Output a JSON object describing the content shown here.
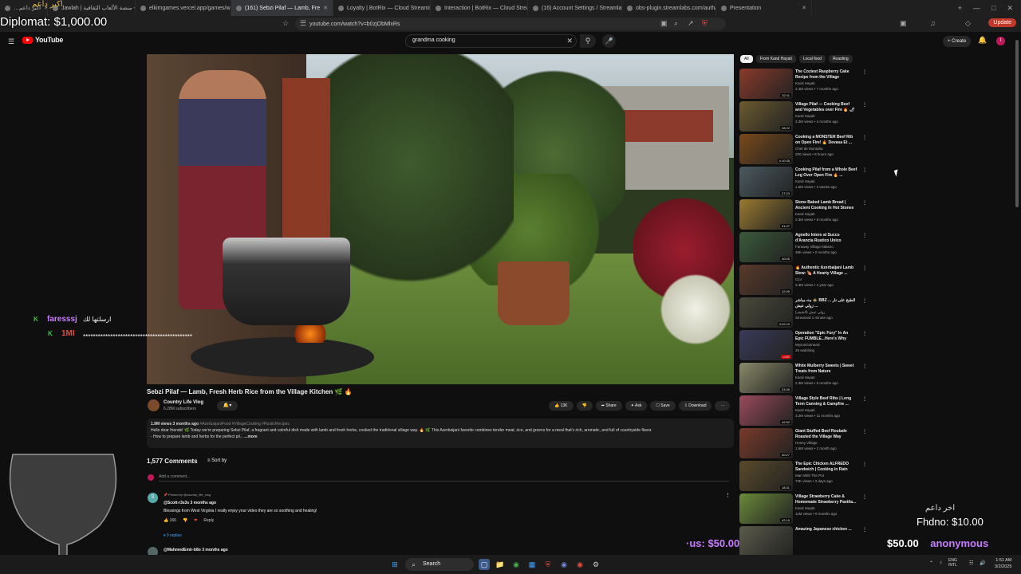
{
  "browser": {
    "tabs": [
      {
        "label": "…اكبر داعم",
        "active": false
      },
      {
        "label": "Jawlah | جولة - منصة الألعاب الثقافية",
        "active": false
      },
      {
        "label": "elkimgames.vercel.app/games/whea",
        "active": false
      },
      {
        "label": "(161) Sebzi Pilaf — Lamb, Fre",
        "active": true
      },
      {
        "label": "Loyalty | BotRix — Cloud Streaming",
        "active": false
      },
      {
        "label": "Interaction | BotRix — Cloud Stream",
        "active": false
      },
      {
        "label": "(16) Account Settings / Streamlabs",
        "active": false
      },
      {
        "label": "obs-plugin.streamlabs.com/auth/su",
        "active": false
      },
      {
        "label": "Presentation",
        "active": false
      }
    ],
    "url": "youtube.com/watch?v=b0zjObMlxRs",
    "update_label": "Update"
  },
  "youtube": {
    "logo_text": "YouTube",
    "search_value": "grandma cooking",
    "create_label": "+ Create",
    "avatar_letter": "I"
  },
  "video": {
    "title": "Sebzi Pilaf — Lamb, Fresh Herb Rice from the Village Kitchen 🌿 🔥",
    "channel": "Country Life Vlog",
    "subscribers": "6.28M subscribers",
    "likes": "13K",
    "actions": {
      "share": "Share",
      "ask": "Ask",
      "save": "Save",
      "download": "Download"
    },
    "description": {
      "meta": "1.9M views 3 months ago",
      "tags": "#AzerbaijaniFood #VillageCooking #RusticRecipes",
      "text": "Hello dear friends! 🌿 Today we're preparing Sebzi Pilaf, a fragrant and colorful dish made with lamb and fresh herbs, cooked the traditional village way. 🔥 🌿 This Azerbaijani favorite combines tender meat, rice, and greens for a meal that's rich, aromatic, and full of countryside flavor.",
      "line2": "- How to prepare lamb and herbs for the perfect pil...",
      "more": "...more"
    }
  },
  "comments": {
    "count": "1,577 Comments",
    "sort_label": "Sort by",
    "add_placeholder": "Add a comment...",
    "pinned": "Pinned by @country_life_vlog",
    "first": {
      "avatar_letter": "S",
      "user": "@Scott-r3s3s 3 months ago",
      "text": "Blessings from West Virginia I really enjoy your video they are so soothing and healing!",
      "likes": "166",
      "reply_label": "Reply",
      "replies": "9 replies"
    },
    "second_user": "@MahmedEmir-b8o 3 months ago"
  },
  "sidebar": {
    "chips": [
      "All",
      "From Kand Hayati",
      "Local food",
      "Roasting"
    ],
    "items": [
      {
        "title": "The Coziest Raspberry Cake Recipe from the Village",
        "channel": "Kand Hayati",
        "meta": "2.4M views • 7 months ago",
        "duration": "32:11",
        "color": "#8a3a2a"
      },
      {
        "title": "Village Pilaf — Cooking Beef and Vegetables over Fire 🔥 🌶",
        "channel": "Kand Hayati",
        "meta": "3.3M views • 4 months ago",
        "duration": "28:22",
        "color": "#6c5a30"
      },
      {
        "title": "Cooking a MONSTER Beef Rib on Open Fire! 🔥 Devasa Et ...",
        "channel": "Chef de Montaña",
        "meta": "200 views • 8 hours ago",
        "duration": "4:10:35",
        "color": "#7a4a1a"
      },
      {
        "title": "Cooking Pilaf from a Whole Beef Leg Over Open Fire 🔥 ...",
        "channel": "Kand Hayati",
        "meta": "1.6M views • 2 weeks ago",
        "duration": "27:23",
        "color": "#4b5a60"
      },
      {
        "title": "Stone Baked Lamb Bread | Ancient Cooking In Hot Stones",
        "channel": "Kand Hayati",
        "meta": "2.3M views • 8 months ago",
        "duration": "31:07",
        "color": "#9a7a30"
      },
      {
        "title": "Agnello Intero al Succo d'Arancia Rustico Unico",
        "channel": "Faraway Village Italiano",
        "meta": "35K views • 2 months ago",
        "duration": "40:05",
        "color": "#3a5a3a"
      },
      {
        "title": "🔥 Authentic Azerbaijani Lamb Stew: 🍖 A Hearty Village ...",
        "channel": "CLV",
        "meta": "3.3M views • 1 year ago",
        "duration": "22:09",
        "color": "#5a3a2a"
      },
      {
        "title": "بث مباشر 🍲 BBZ الطبخ على نار ... زولي عيش ...",
        "channel": "زولي عيش (الشيف)",
        "meta": "Streamed 1 minute ago",
        "duration": "3:02:23",
        "color": "#4a4a3a"
      },
      {
        "title": "Operation \"Epic Fury\" In An Epic FUMBLE...Here's Why Going T...",
        "channel": "MysonGuineaS",
        "meta": "25 watching",
        "duration": "LIVE",
        "color": "#3a3a5a"
      },
      {
        "title": "White Mulberry Sweets | Sweet Treats from Nature",
        "channel": "Kand Hayati",
        "meta": "2.3M views • 6 months ago",
        "duration": "23:39",
        "color": "#8a8a6a"
      },
      {
        "title": "Village Style Beef Ribs | Long Term Canning & Campfire ...",
        "channel": "Kand Hayati",
        "meta": "3.2M views • 11 months ago",
        "duration": "42:52",
        "color": "#9a4a5a"
      },
      {
        "title": "Giant Stuffed Beef Roulade Roasted the Village Way",
        "channel": "Honey Village",
        "meta": "1.6M views • 1 month ago",
        "duration": "30:27",
        "color": "#7a3a2a"
      },
      {
        "title": "The Epic Chicken ALFREDO Sandwich | Cooking in Rain",
        "channel": "Man With The Pot",
        "meta": "73K views • 3 days ago",
        "duration": "18:31",
        "color": "#5a4a2a"
      },
      {
        "title": "Village Strawberry Cake & Homemade Strawberry Pastila...",
        "channel": "Kand Hayati",
        "meta": "11M views • 9 months ago",
        "duration": "42:15",
        "color": "#6a8a3a"
      },
      {
        "title": "Amazing Japanese chicken ...",
        "channel": "",
        "meta": "",
        "duration": "",
        "color": "#5a5a4a"
      }
    ]
  },
  "overlay": {
    "top_arabic": "اكبر داعم",
    "diplomat": "Diplomat: $1,000.00",
    "chat": [
      {
        "badge": "K",
        "name": "faresssj",
        "message": "ارسلتها لك"
      },
      {
        "badge": "K",
        "name": "1MI",
        "message": "********************************************"
      }
    ],
    "donor_label": "اخر داعم",
    "donor": "Fhdno: $10.00",
    "ticker_a": "·us: $50.00",
    "ticker_b": "$50.00",
    "ticker_c": "anonymous"
  },
  "taskbar": {
    "search_label": "Search",
    "lang": "ENG INTL",
    "time": "1:51 AM",
    "date": "3/2/2025"
  }
}
